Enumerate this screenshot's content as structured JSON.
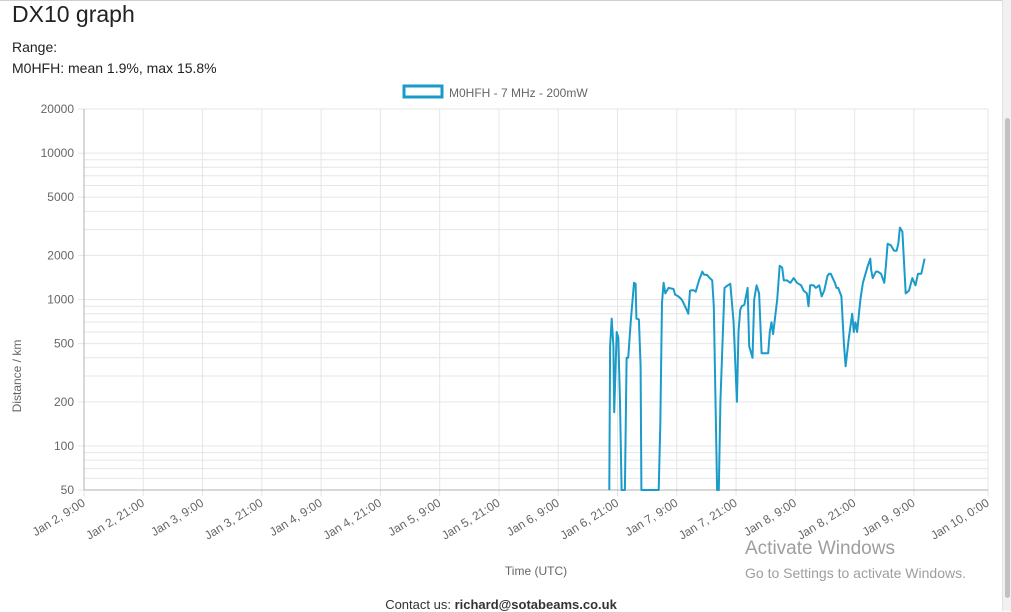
{
  "page": {
    "title": "DX10 graph",
    "range_label": "Range:",
    "stats": "M0HFH: mean 1.9%, max 15.8%"
  },
  "footer": {
    "prefix": "Contact us: ",
    "email": "richard@sotabeams.co.uk"
  },
  "watermark": {
    "title": "Activate Windows",
    "subtitle": "Go to Settings to activate Windows."
  },
  "colors": {
    "series": "#1a9bc9",
    "grid": "#e6e6e6",
    "axis": "#b0b0b0",
    "text": "#666666"
  },
  "chart_data": {
    "type": "line",
    "title": "",
    "xlabel": "Time (UTC)",
    "ylabel": "Distance / km",
    "yscale": "log",
    "ylim": [
      50,
      20000
    ],
    "y_ticks": [
      50,
      100,
      200,
      500,
      1000,
      2000,
      5000,
      10000,
      20000
    ],
    "xlim": [
      "Jan 2, 9:00",
      "Jan 10, 0:00"
    ],
    "x_ticks": [
      "Jan 2, 9:00",
      "Jan 2, 21:00",
      "Jan 3, 9:00",
      "Jan 3, 21:00",
      "Jan 4, 9:00",
      "Jan 4, 21:00",
      "Jan 5, 9:00",
      "Jan 5, 21:00",
      "Jan 6, 9:00",
      "Jan 6, 21:00",
      "Jan 7, 9:00",
      "Jan 7, 21:00",
      "Jan 8, 9:00",
      "Jan 8, 21:00",
      "Jan 9, 9:00",
      "Jan 10, 0:00"
    ],
    "grid": true,
    "legend": "top-center",
    "series": [
      {
        "name": "M0HFH - 7 MHz - 200mW",
        "points": [
          [
            "Jan 6, 19:20",
            50
          ],
          [
            "Jan 6, 19:30",
            480
          ],
          [
            "Jan 6, 19:50",
            740
          ],
          [
            "Jan 6, 20:10",
            480
          ],
          [
            "Jan 6, 20:20",
            170
          ],
          [
            "Jan 6, 20:50",
            600
          ],
          [
            "Jan 6, 21:10",
            550
          ],
          [
            "Jan 6, 21:30",
            200
          ],
          [
            "Jan 6, 21:50",
            50
          ],
          [
            "Jan 6, 22:30",
            50
          ],
          [
            "Jan 6, 22:50",
            400
          ],
          [
            "Jan 6, 23:10",
            400
          ],
          [
            "Jan 6, 23:40",
            700
          ],
          [
            "Jan 7, 0:20",
            1300
          ],
          [
            "Jan 7, 0:40",
            1280
          ],
          [
            "Jan 7, 0:50",
            740
          ],
          [
            "Jan 7, 1:20",
            730
          ],
          [
            "Jan 7, 1:40",
            350
          ],
          [
            "Jan 7, 1:50",
            50
          ],
          [
            "Jan 7, 5:20",
            50
          ],
          [
            "Jan 7, 5:40",
            140
          ],
          [
            "Jan 7, 6:00",
            950
          ],
          [
            "Jan 7, 6:20",
            1300
          ],
          [
            "Jan 7, 6:40",
            1100
          ],
          [
            "Jan 7, 7:20",
            1200
          ],
          [
            "Jan 7, 8:20",
            1180
          ],
          [
            "Jan 7, 8:40",
            1080
          ],
          [
            "Jan 7, 9:20",
            1050
          ],
          [
            "Jan 7, 10:00",
            1000
          ],
          [
            "Jan 7, 10:20",
            950
          ],
          [
            "Jan 7, 11:00",
            850
          ],
          [
            "Jan 7, 11:20",
            800
          ],
          [
            "Jan 7, 11:40",
            1150
          ],
          [
            "Jan 7, 12:20",
            1160
          ],
          [
            "Jan 7, 12:50",
            1130
          ],
          [
            "Jan 7, 13:30",
            1350
          ],
          [
            "Jan 7, 14:10",
            1550
          ],
          [
            "Jan 7, 14:30",
            1480
          ],
          [
            "Jan 7, 15:10",
            1470
          ],
          [
            "Jan 7, 15:30",
            1420
          ],
          [
            "Jan 7, 16:10",
            1350
          ],
          [
            "Jan 7, 16:30",
            900
          ],
          [
            "Jan 7, 17:10",
            50
          ],
          [
            "Jan 7, 17:30",
            50
          ],
          [
            "Jan 7, 17:50",
            200
          ],
          [
            "Jan 7, 18:20",
            600
          ],
          [
            "Jan 7, 18:40",
            1200
          ],
          [
            "Jan 7, 19:20",
            1250
          ],
          [
            "Jan 7, 19:50",
            1280
          ],
          [
            "Jan 7, 20:30",
            700
          ],
          [
            "Jan 7, 21:10",
            200
          ],
          [
            "Jan 7, 21:30",
            600
          ],
          [
            "Jan 7, 21:50",
            850
          ],
          [
            "Jan 7, 22:10",
            900
          ],
          [
            "Jan 7, 22:40",
            920
          ],
          [
            "Jan 7, 23:20",
            1200
          ],
          [
            "Jan 7, 23:40",
            480
          ],
          [
            "Jan 8, 0:20",
            400
          ],
          [
            "Jan 8, 0:40",
            1000
          ],
          [
            "Jan 8, 1:10",
            1250
          ],
          [
            "Jan 8, 1:40",
            1100
          ],
          [
            "Jan 8, 2:10",
            430
          ],
          [
            "Jan 8, 3:30",
            430
          ],
          [
            "Jan 8, 3:50",
            600
          ],
          [
            "Jan 8, 4:10",
            700
          ],
          [
            "Jan 8, 4:30",
            580
          ],
          [
            "Jan 8, 5:20",
            1000
          ],
          [
            "Jan 8, 5:50",
            1700
          ],
          [
            "Jan 8, 6:20",
            1650
          ],
          [
            "Jan 8, 6:40",
            1350
          ],
          [
            "Jan 8, 7:20",
            1350
          ],
          [
            "Jan 8, 8:00",
            1300
          ],
          [
            "Jan 8, 8:40",
            1400
          ],
          [
            "Jan 8, 9:20",
            1300
          ],
          [
            "Jan 8, 10:10",
            1250
          ],
          [
            "Jan 8, 10:40",
            1150
          ],
          [
            "Jan 8, 11:20",
            1100
          ],
          [
            "Jan 8, 11:40",
            900
          ],
          [
            "Jan 8, 12:00",
            1250
          ],
          [
            "Jan 8, 12:40",
            1250
          ],
          [
            "Jan 8, 13:10",
            1200
          ],
          [
            "Jan 8, 13:50",
            1250
          ],
          [
            "Jan 8, 14:20",
            1050
          ],
          [
            "Jan 8, 14:50",
            1150
          ],
          [
            "Jan 8, 15:30",
            1450
          ],
          [
            "Jan 8, 15:50",
            1500
          ],
          [
            "Jan 8, 16:10",
            1500
          ],
          [
            "Jan 8, 17:00",
            1300
          ],
          [
            "Jan 8, 17:20",
            1200
          ],
          [
            "Jan 8, 17:40",
            1200
          ],
          [
            "Jan 8, 18:20",
            1050
          ],
          [
            "Jan 8, 18:50",
            500
          ],
          [
            "Jan 8, 19:10",
            350
          ],
          [
            "Jan 8, 19:50",
            550
          ],
          [
            "Jan 8, 20:30",
            800
          ],
          [
            "Jan 8, 20:50",
            600
          ],
          [
            "Jan 8, 21:10",
            700
          ],
          [
            "Jan 8, 21:30",
            600
          ],
          [
            "Jan 8, 22:10",
            1000
          ],
          [
            "Jan 8, 22:40",
            1300
          ],
          [
            "Jan 8, 23:40",
            1700
          ],
          [
            "Jan 9, 0:10",
            1900
          ],
          [
            "Jan 9, 0:20",
            1600
          ],
          [
            "Jan 9, 0:40",
            1400
          ],
          [
            "Jan 9, 1:20",
            1550
          ],
          [
            "Jan 9, 1:40",
            1550
          ],
          [
            "Jan 9, 2:20",
            1500
          ],
          [
            "Jan 9, 3:00",
            1300
          ],
          [
            "Jan 9, 3:20",
            1700
          ],
          [
            "Jan 9, 3:40",
            2400
          ],
          [
            "Jan 9, 4:20",
            2350
          ],
          [
            "Jan 9, 5:00",
            2150
          ],
          [
            "Jan 9, 5:30",
            2150
          ],
          [
            "Jan 9, 5:50",
            2400
          ],
          [
            "Jan 9, 6:10",
            3100
          ],
          [
            "Jan 9, 6:40",
            2900
          ],
          [
            "Jan 9, 7:20",
            1100
          ],
          [
            "Jan 9, 8:00",
            1150
          ],
          [
            "Jan 9, 8:40",
            1400
          ],
          [
            "Jan 9, 9:20",
            1250
          ],
          [
            "Jan 9, 9:50",
            1500
          ],
          [
            "Jan 9, 10:30",
            1500
          ],
          [
            "Jan 9, 11:10",
            1900
          ]
        ]
      }
    ]
  }
}
